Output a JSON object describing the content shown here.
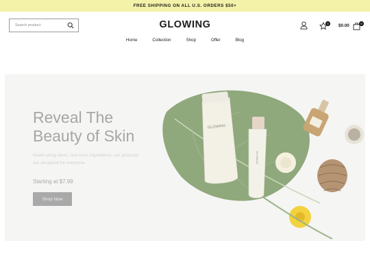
{
  "announcement": {
    "text": "FREE SHIPPING ON ALL U.S. ORDERS $50+"
  },
  "header": {
    "search_placeholder": "Search product",
    "logo": "GLOWING",
    "wishlist_count": "0",
    "cart_total": "$0.00",
    "cart_count": "0"
  },
  "nav": {
    "items": [
      "Home",
      "Collection",
      "Shop",
      "Offer",
      "Blog"
    ]
  },
  "hero": {
    "title_line1": "Reveal The",
    "title_line2": "Beauty of Skin",
    "subtitle_line1": "Made using clean, non-toxic ingredients, our products",
    "subtitle_line2": "are designed for everyone.",
    "price_text": "Starting at $7.99",
    "button_label": "Shop Now",
    "product_tube_label": "GLOWING",
    "product_small_label": "GLOWING"
  },
  "colors": {
    "announcement_bg": "#f4f1a9",
    "hero_bg": "#f5f5f4",
    "button_bg": "#a9a9a9",
    "leaf": "#8fa87c"
  },
  "icons": [
    "search-icon",
    "user-icon",
    "star-icon",
    "shopping-bag-icon"
  ]
}
